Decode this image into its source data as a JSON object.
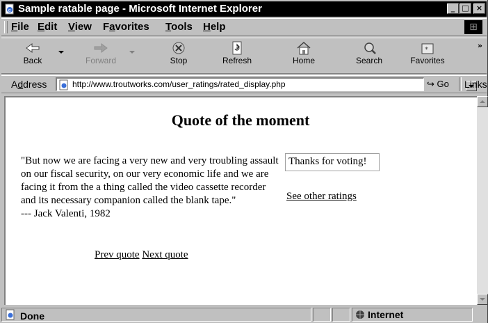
{
  "window": {
    "title": "Sample ratable page - Microsoft Internet Explorer",
    "controls": [
      "minimize",
      "maximize",
      "close"
    ]
  },
  "menu": {
    "items": [
      {
        "label": "File",
        "accel": "F",
        "rest": "ile"
      },
      {
        "label": "Edit",
        "accel": "E",
        "rest": "dit"
      },
      {
        "label": "View",
        "accel": "V",
        "rest": "iew"
      },
      {
        "label": "Favorites",
        "accel": "a",
        "prefix": "F",
        "rest": "vorites"
      },
      {
        "label": "Tools",
        "accel": "T",
        "rest": "ools"
      },
      {
        "label": "Help",
        "accel": "H",
        "rest": "elp"
      }
    ]
  },
  "toolbar": {
    "back_label": "Back",
    "forward_label": "Forward",
    "stop_label": "Stop",
    "refresh_label": "Refresh",
    "home_label": "Home",
    "search_label": "Search",
    "favorites_label": "Favorites",
    "chevron": "»"
  },
  "address": {
    "label": "Address",
    "accel": "d",
    "url": "http://www.troutworks.com/user_ratings/rated_display.php",
    "go_label": "Go",
    "links_label": "Links"
  },
  "page": {
    "title": "Quote of the moment",
    "quote_text": "\"But now we are facing a very new and very troubling assault on our fiscal security, on our very economic life and we are facing it from the a thing called the video cassette recorder and its necessary companion called the blank tape.\"",
    "attribution": "--- Jack Valenti, 1982",
    "prev_link": "Prev quote",
    "next_link": "Next quote",
    "vote_message": "Thanks for voting!",
    "other_ratings_link": "See other ratings"
  },
  "status": {
    "text": "Done",
    "zone": "Internet"
  },
  "icons": {
    "app": "ie-page-icon",
    "back": "back-arrow-icon",
    "forward": "forward-arrow-icon",
    "stop": "stop-icon",
    "refresh": "refresh-icon",
    "home": "home-icon",
    "search": "search-icon",
    "favorites": "favorites-icon",
    "zone": "internet-globe-icon"
  }
}
